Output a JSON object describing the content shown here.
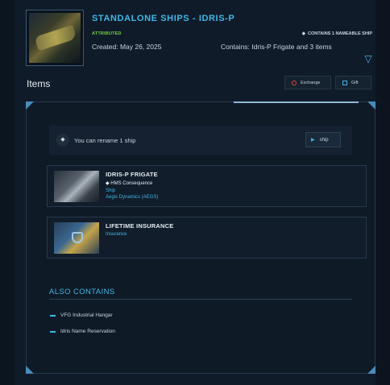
{
  "header": {
    "title": "STANDALONE SHIPS - IDRIS-P",
    "attributed_label": "ATTRIBUTED",
    "nameable_label": "CONTAINS 1 NAMEABLE SHIP",
    "created": "Created: May 26, 2025",
    "contains": "Contains: Idris-P Frigate and 3 items",
    "collapse_icon": "chevron-down-icon"
  },
  "items_section": {
    "heading": "Items",
    "exchange_label": "Exchange",
    "gift_label": "Gift"
  },
  "rename": {
    "text": "You can rename 1 ship",
    "button_label": "ship"
  },
  "items": [
    {
      "name": "IDRIS-P FRIGATE",
      "ship_name": "HMS Consequence",
      "type": "Ship",
      "manufacturer": "Aegis Dynamics (AEGS)"
    },
    {
      "name": "LIFETIME INSURANCE",
      "type": "Insurance"
    }
  ],
  "also_contains": {
    "heading": "ALSO CONTAINS",
    "items": [
      "VFG Industrial Hangar",
      "Idris Name Reservation"
    ]
  },
  "colors": {
    "accent": "#3fb7e6",
    "attributed": "#6fd23d",
    "exchange_icon": "#e0483b",
    "background": "#101b29"
  }
}
